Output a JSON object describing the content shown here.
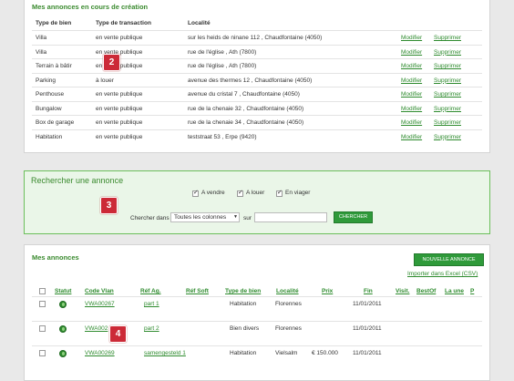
{
  "draft": {
    "title": "Mes annonces en cours de création",
    "headers": [
      "Type de bien",
      "Type de transaction",
      "Localité"
    ],
    "rows": [
      {
        "type": "Villa",
        "transaction": "en vente publique",
        "locality": "sur les heids de ninane 112 , Chaudfontaine (4050)",
        "modify": "Modifier",
        "delete": "Supprimer"
      },
      {
        "type": "Villa",
        "transaction": "en vente publique",
        "locality": "rue de l'église , Ath (7800)",
        "modify": "Modifier",
        "delete": "Supprimer"
      },
      {
        "type": "Terrain à bâtir",
        "transaction": "en vente publique",
        "locality": "rue de l'église , Ath (7800)",
        "modify": "Modifier",
        "delete": "Supprimer"
      },
      {
        "type": "Parking",
        "transaction": "à louer",
        "locality": "avenue des thermes 12 , Chaudfontaine (4050)",
        "modify": "Modifier",
        "delete": "Supprimer"
      },
      {
        "type": "Penthouse",
        "transaction": "en vente publique",
        "locality": "avenue du cristal 7 , Chaudfontaine (4050)",
        "modify": "Modifier",
        "delete": "Supprimer"
      },
      {
        "type": "Bungalow",
        "transaction": "en vente publique",
        "locality": "rue de la chenaie 32 , Chaudfontaine (4050)",
        "modify": "Modifier",
        "delete": "Supprimer"
      },
      {
        "type": "Box de garage",
        "transaction": "en vente publique",
        "locality": "rue de la chenaie 34 , Chaudfontaine (4050)",
        "modify": "Modifier",
        "delete": "Supprimer"
      },
      {
        "type": "Habitation",
        "transaction": "en vente publique",
        "locality": "teststraat 53 , Erpe (9420)",
        "modify": "Modifier",
        "delete": "Supprimer"
      }
    ]
  },
  "search": {
    "title": "Rechercher une annonce",
    "checkboxes": [
      {
        "label": "A vendre",
        "checked": true
      },
      {
        "label": "A louer",
        "checked": true
      },
      {
        "label": "En viager",
        "checked": true
      }
    ],
    "search_in_label": "Chercher dans",
    "column_select": "Toutes les colonnes",
    "on_label": "sur",
    "input_value": "",
    "button": "CHERCHER"
  },
  "listings": {
    "title": "Mes annonces",
    "new_button": "NOUVELLE ANNONCE",
    "import_link": "Importer dans Excel (CSV)",
    "headers": [
      "Statut",
      "Code Vlan",
      "Réf Ag.",
      "Réf Soft",
      "Type de bien",
      "Localité",
      "Prix",
      "Fin",
      "Visit.",
      "BestOf",
      "La une",
      "P"
    ],
    "rows": [
      {
        "code": "VWA00267",
        "ref_ag": "part 1",
        "ref_soft": "",
        "type": "Habitation",
        "locality": "Florennes",
        "price": "",
        "end": "11/01/2011"
      },
      {
        "code": "VWA002",
        "ref_ag": "part 2",
        "ref_soft": "",
        "type": "Bien divers",
        "locality": "Florennes",
        "price": "",
        "end": "11/01/2011"
      },
      {
        "code": "VWA00269",
        "ref_ag": "samengesteld 1",
        "ref_soft": "",
        "type": "Habitation",
        "locality": "Vielsalm",
        "price": "€ 150.000",
        "end": "11/01/2011"
      }
    ]
  },
  "badges": [
    "2",
    "3",
    "4"
  ]
}
